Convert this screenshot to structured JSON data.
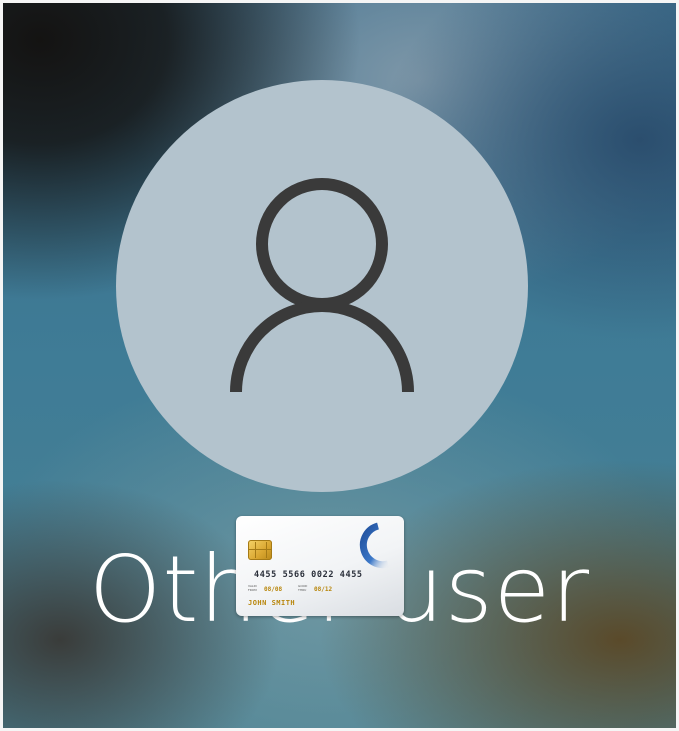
{
  "login": {
    "user_name": "Other user"
  },
  "avatar": {
    "icon": "user-silhouette-icon"
  },
  "smart_card": {
    "icon": "smart-card-icon",
    "number": "4455 5566 0022 4455",
    "valid_from_caption": "VALID FROM",
    "valid_from": "08/08",
    "valid_thru_caption": "GOOD THRU",
    "valid_thru": "08/12",
    "holder": "JOHN SMITH"
  },
  "colors": {
    "avatar_fill": "#b3c3cd",
    "avatar_glyph": "#3a3a3a",
    "text": "#ffffff",
    "card_accent": "#b8860b",
    "card_logo_blue": "#1f4f9c"
  }
}
